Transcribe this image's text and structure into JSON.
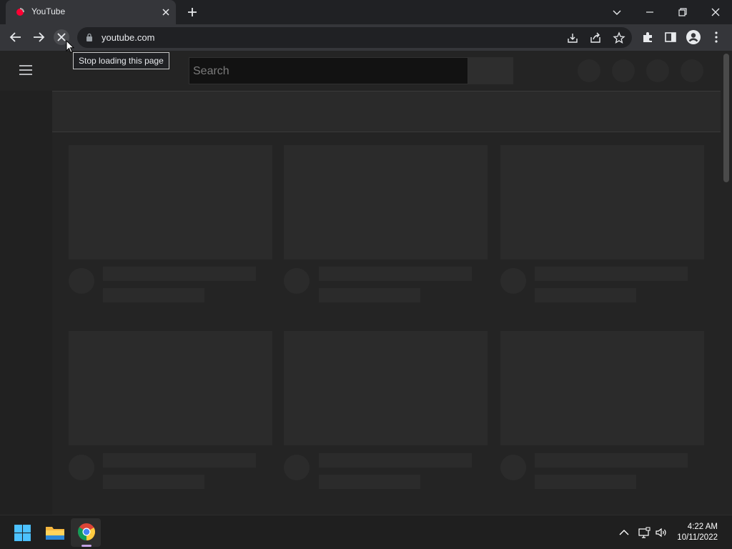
{
  "browser": {
    "tab": {
      "title": "YouTube",
      "favicon": "youtube-favicon-icon"
    },
    "address": {
      "url": "youtube.com"
    },
    "tooltip": "Stop loading this page",
    "colors": {
      "frame": "#202124",
      "toolbar": "#35363a",
      "text": "#e8eaed"
    }
  },
  "page": {
    "search": {
      "placeholder": "Search"
    },
    "skeleton_color": "#2b2b2b",
    "background": "#242424"
  },
  "taskbar": {
    "apps": [
      "windows-start-icon",
      "file-explorer-icon",
      "chrome-icon"
    ],
    "clock": {
      "time": "4:22 AM",
      "date": "10/11/2022"
    }
  }
}
